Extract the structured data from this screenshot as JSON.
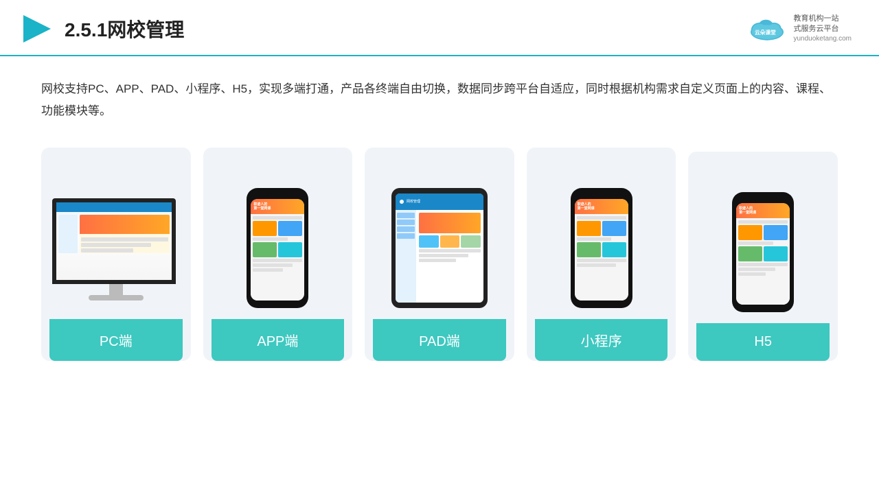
{
  "header": {
    "title": "2.5.1网校管理",
    "logo_name": "云朵课堂",
    "logo_sub1": "教育机构一站",
    "logo_sub2": "式服务云平台",
    "logo_url": "yunduoketang.com"
  },
  "description": "网校支持PC、APP、PAD、小程序、H5，实现多端打通，产品各终端自由切换，数据同步跨平台自适应，同时根据机构需求自定义页面上的内容、课程、功能模块等。",
  "cards": [
    {
      "id": "pc",
      "label": "PC端"
    },
    {
      "id": "app",
      "label": "APP端"
    },
    {
      "id": "pad",
      "label": "PAD端"
    },
    {
      "id": "miniapp",
      "label": "小程序"
    },
    {
      "id": "h5",
      "label": "H5"
    }
  ],
  "accent_color": "#3dc8c0"
}
